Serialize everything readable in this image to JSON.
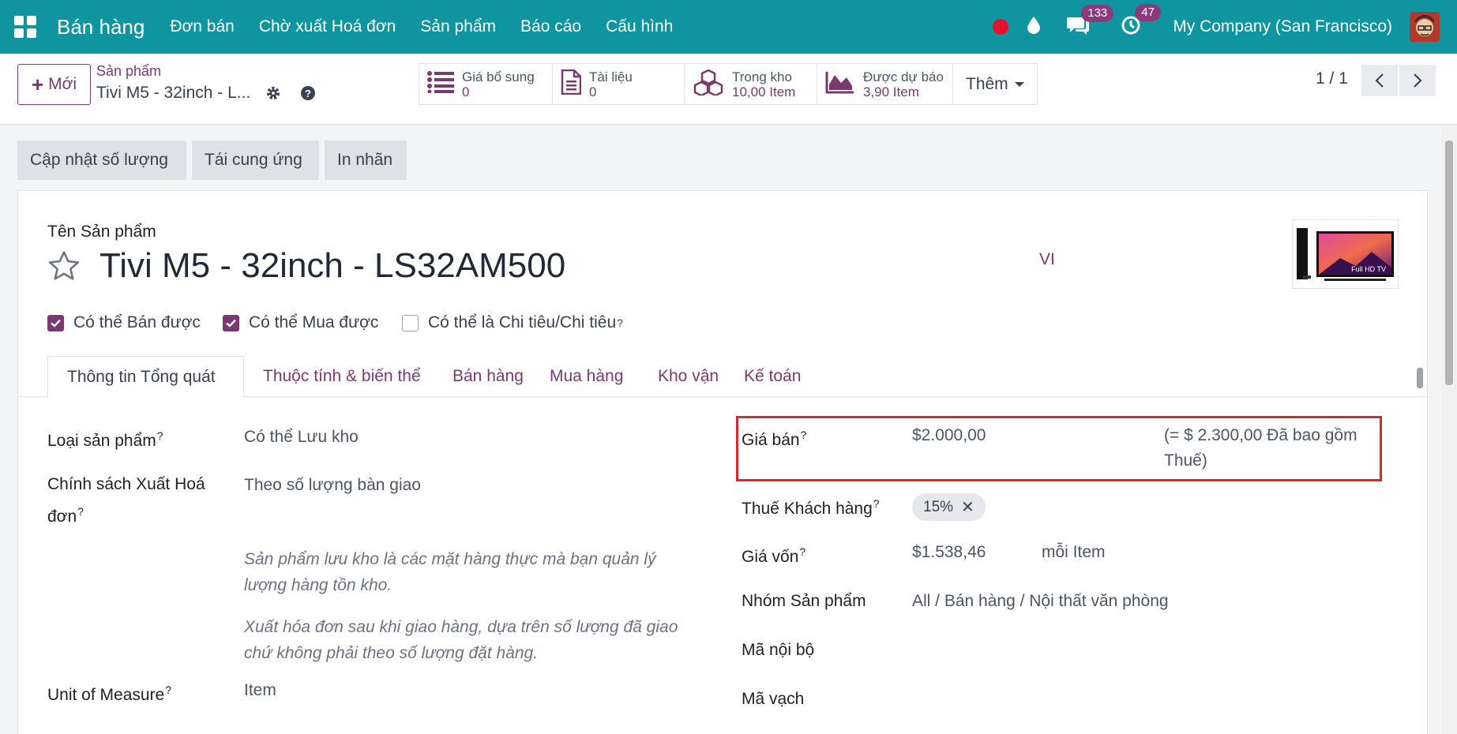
{
  "topnav": {
    "brand": "Bán hàng",
    "menu": [
      "Đơn bán",
      "Chờ xuất Hoá đơn",
      "Sản phẩm",
      "Báo cáo",
      "Cấu hình"
    ],
    "messages_count": "133",
    "activities_count": "47",
    "company": "My Company (San Francisco)"
  },
  "control_panel": {
    "new_label": "Mới",
    "breadcrumb_parent": "Sản phẩm",
    "breadcrumb_current": "Tivi M5 - 32inch - L...",
    "smart_buttons": [
      {
        "label": "Giá bổ sung",
        "value": "0",
        "icon": "list-icon"
      },
      {
        "label": "Tài liệu",
        "value": "0",
        "icon": "document-icon"
      },
      {
        "label": "Trong kho",
        "value": "10,00 Item",
        "icon": "cubes-icon"
      },
      {
        "label": "Được dự báo",
        "value": "3,90 Item",
        "icon": "area-chart-icon"
      }
    ],
    "more_label": "Thêm",
    "pager": "1 / 1"
  },
  "actions": [
    "Cập nhật số lượng",
    "Tái cung ứng",
    "In nhãn"
  ],
  "form": {
    "name_label": "Tên Sản phẩm",
    "name": "Tivi M5 - 32inch - LS32AM500",
    "lang": "VI",
    "image_caption": "Full HD TV",
    "checkboxes": [
      {
        "label": "Có thể Bán được",
        "checked": true
      },
      {
        "label": "Có thể Mua được",
        "checked": true
      },
      {
        "label": "Có thể là Chi tiêu/Chi tiêu",
        "checked": false,
        "help": "?"
      }
    ],
    "tabs": [
      "Thông tin Tổng quát",
      "Thuộc tính & biến thể",
      "Bán hàng",
      "Mua hàng",
      "Kho vận",
      "Kế toán"
    ],
    "left": {
      "product_type_label": "Loại sản phẩm",
      "product_type": "Có thể Lưu kho",
      "invoice_policy_label_1": "Chính sách Xuất Hoá",
      "invoice_policy_label_2": "đơn",
      "invoice_policy": "Theo số lượng bàn giao",
      "help_1_line1": "Sản phẩm lưu kho là các mặt hàng thực mà bạn quản lý",
      "help_1_line2": "lượng hàng tồn kho.",
      "help_2_line1": "Xuất hóa đơn sau khi giao hàng, dựa trên số lượng đã giao",
      "help_2_line2": "chứ không phải theo số lượng đặt hàng.",
      "uom_label": "Unit of Measure",
      "uom": "Item"
    },
    "right": {
      "sale_price_label": "Giá bán",
      "sale_price": "$2.000,00",
      "sale_price_tax_line1": "(= $ 2.300,00 Đã bao gồm",
      "sale_price_tax_line2": "Thuế)",
      "customer_tax_label": "Thuế Khách hàng",
      "customer_tax": "15%",
      "cost_label": "Giá vốn",
      "cost": "$1.538,46",
      "cost_unit": "mỗi Item",
      "category_label": "Nhóm Sản phẩm",
      "category": "All / Bán hàng / Nội thất văn phòng",
      "internal_ref_label": "Mã nội bộ",
      "barcode_label": "Mã vạch"
    },
    "help_mark": "?"
  },
  "colors": {
    "nav": "#0f959f",
    "accent": "#7a3a6f",
    "highlight": "#d9272e"
  }
}
